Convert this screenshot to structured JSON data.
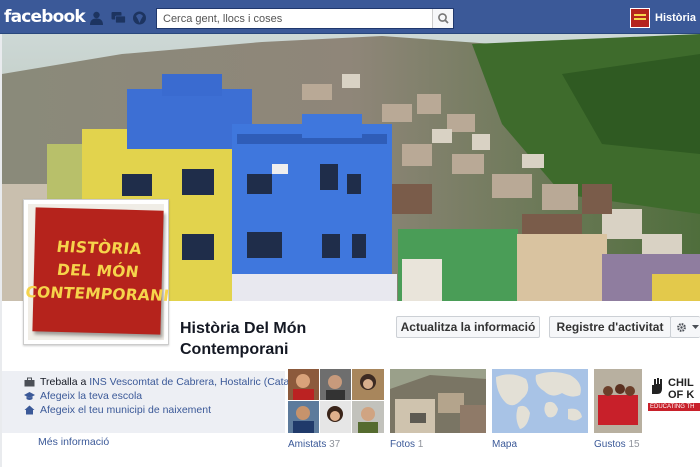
{
  "topbar": {
    "logo": "facebook",
    "search_placeholder": "Cerca gent, llocs i coses",
    "profile_name": "Història"
  },
  "profile": {
    "picture_lines": [
      "HISTÒRIA",
      "DEL MÓN",
      "CONTEMPORANI"
    ],
    "title": "Història Del Món Contemporani"
  },
  "actions": {
    "update_info": "Actualitza la informació",
    "activity_log": "Registre d'activitat"
  },
  "about": {
    "work_prefix": "Treballa a",
    "work_place": "INS Vescomtat de Cabrera, Hostalric (Catalu...",
    "add_school": "Afegeix la teva escola",
    "add_hometown": "Afegeix el teu municipi de naixement",
    "more_info": "Més informació"
  },
  "tiles": [
    {
      "label": "Amistats",
      "count": "37"
    },
    {
      "label": "Fotos",
      "count": "1"
    },
    {
      "label": "Mapa",
      "count": ""
    },
    {
      "label": "Gustos",
      "count": "15"
    }
  ],
  "gustos_thumb": {
    "line1": "CHIL",
    "line2": "OF K",
    "line3": "EDUCATING TH"
  },
  "colors": {
    "brand_blue": "#3b5998",
    "link_blue": "#3b5998",
    "note_red": "#b5231c",
    "note_yellow": "#f6d44b"
  },
  "icons": [
    "friends-icon",
    "messages-icon",
    "notifications-icon",
    "search-icon",
    "briefcase-icon",
    "school-icon",
    "home-icon",
    "gear-icon",
    "chevron-down-icon"
  ]
}
